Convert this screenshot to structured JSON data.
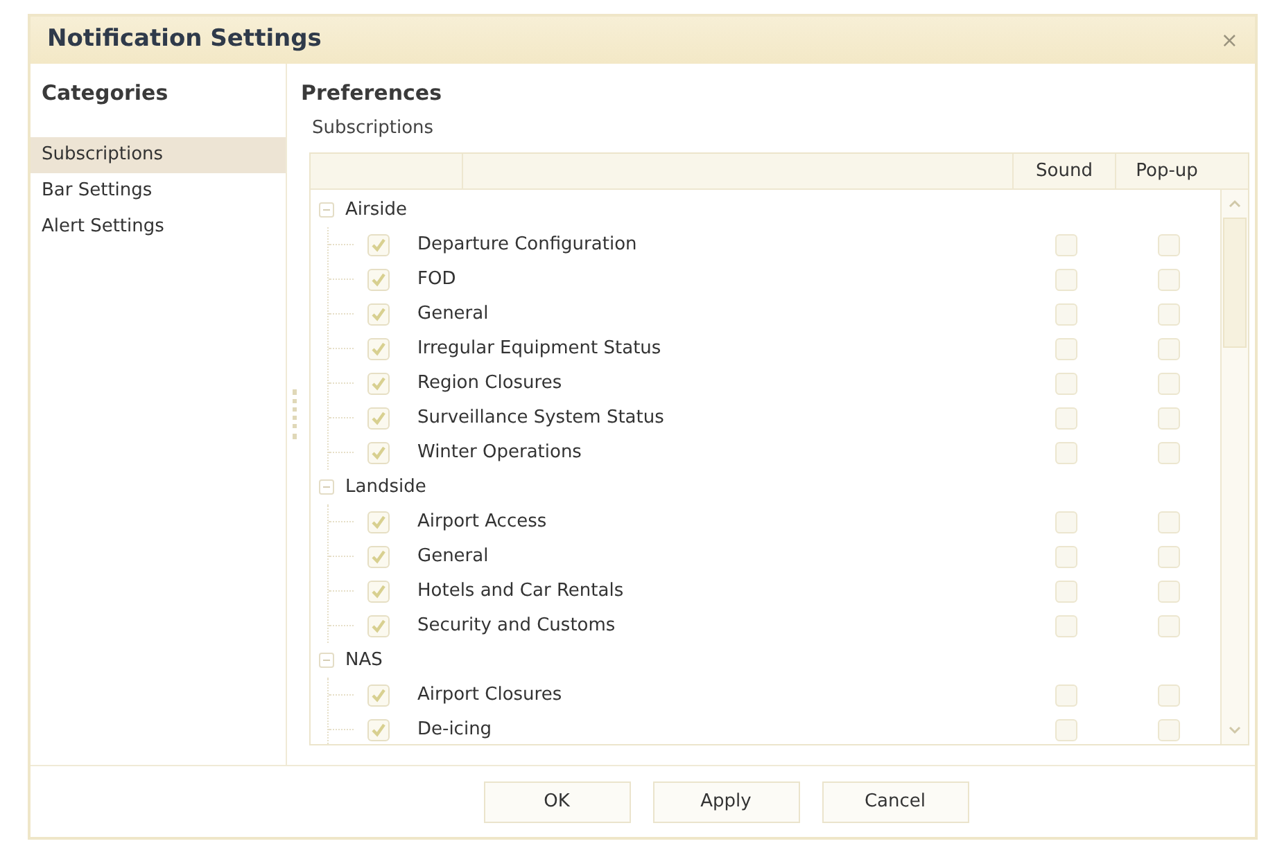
{
  "window": {
    "title": "Notification Settings",
    "close": "×"
  },
  "categories": {
    "heading": "Categories",
    "items": [
      {
        "label": "Subscriptions",
        "selected": true
      },
      {
        "label": "Bar Settings",
        "selected": false
      },
      {
        "label": "Alert Settings",
        "selected": false
      }
    ]
  },
  "preferences": {
    "heading": "Preferences",
    "section_label": "Subscriptions",
    "table": {
      "columns": [
        "Sound",
        "Pop-up"
      ],
      "groups": [
        {
          "label": "Airside",
          "expanded": true,
          "children": [
            {
              "label": "Departure Configuration",
              "subscribed": true,
              "sound": false,
              "popup": false
            },
            {
              "label": "FOD",
              "subscribed": true,
              "sound": false,
              "popup": false
            },
            {
              "label": "General",
              "subscribed": true,
              "sound": false,
              "popup": false
            },
            {
              "label": "Irregular Equipment Status",
              "subscribed": true,
              "sound": false,
              "popup": false
            },
            {
              "label": "Region Closures",
              "subscribed": true,
              "sound": false,
              "popup": false
            },
            {
              "label": "Surveillance System Status",
              "subscribed": true,
              "sound": false,
              "popup": false
            },
            {
              "label": "Winter Operations",
              "subscribed": true,
              "sound": false,
              "popup": false
            }
          ]
        },
        {
          "label": "Landside",
          "expanded": true,
          "children": [
            {
              "label": "Airport Access",
              "subscribed": true,
              "sound": false,
              "popup": false
            },
            {
              "label": "General",
              "subscribed": true,
              "sound": false,
              "popup": false
            },
            {
              "label": "Hotels and Car Rentals",
              "subscribed": true,
              "sound": false,
              "popup": false
            },
            {
              "label": "Security and Customs",
              "subscribed": true,
              "sound": false,
              "popup": false
            }
          ]
        },
        {
          "label": "NAS",
          "expanded": true,
          "children": [
            {
              "label": "Airport Closures",
              "subscribed": true,
              "sound": false,
              "popup": false
            },
            {
              "label": "De-icing",
              "subscribed": true,
              "sound": false,
              "popup": false
            }
          ]
        }
      ]
    }
  },
  "buttons": [
    "OK",
    "Apply",
    "Cancel"
  ]
}
